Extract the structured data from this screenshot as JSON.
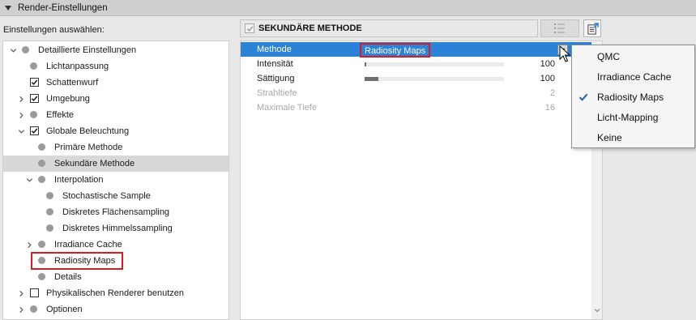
{
  "panel": {
    "title": "Render-Einstellungen"
  },
  "selector": {
    "label": "Einstellungen auswählen:"
  },
  "tree": [
    {
      "label": "Detaillierte Einstellungen",
      "type": "dot",
      "chevron": "down"
    },
    {
      "label": "Lichtanpassung",
      "type": "dot"
    },
    {
      "label": "Schattenwurf",
      "type": "checkbox",
      "checked": true
    },
    {
      "label": "Umgebung",
      "type": "checkbox",
      "checked": true,
      "chevron": "right"
    },
    {
      "label": "Effekte",
      "type": "dot",
      "chevron": "right"
    },
    {
      "label": "Globale Beleuchtung",
      "type": "checkbox",
      "checked": true,
      "chevron": "down"
    },
    {
      "label": "Primäre Methode",
      "type": "dot"
    },
    {
      "label": "Sekundäre Methode",
      "type": "dot",
      "selected": true
    },
    {
      "label": "Interpolation",
      "type": "dot",
      "chevron": "down"
    },
    {
      "label": "Stochastische Sample",
      "type": "dot"
    },
    {
      "label": "Diskretes Flächensampling",
      "type": "dot"
    },
    {
      "label": "Diskretes Himmelssampling",
      "type": "dot"
    },
    {
      "label": "Irradiance Cache",
      "type": "dot",
      "chevron": "right"
    },
    {
      "label": "Radiosity Maps",
      "type": "dot",
      "highlighted": true
    },
    {
      "label": "Details",
      "type": "dot"
    },
    {
      "label": "Physikalischen Renderer benutzen",
      "type": "checkbox",
      "checked": false,
      "chevron": "right"
    },
    {
      "label": "Optionen",
      "type": "dot",
      "chevron": "right"
    }
  ],
  "header": {
    "title": "SEKUNDÄRE METHODE",
    "checked": true
  },
  "properties": [
    {
      "name": "Methode",
      "value": "Radiosity Maps"
    },
    {
      "name": "Intensität",
      "value": "100",
      "level": 0.01
    },
    {
      "name": "Sättigung",
      "value": "100",
      "level": 0.1
    },
    {
      "name": "Strahltiefe",
      "value": "2",
      "disabled": true
    },
    {
      "name": "Maximale Tiefe",
      "value": "16",
      "disabled": true
    }
  ],
  "dropdown": {
    "options": [
      "QMC",
      "Irradiance Cache",
      "Radiosity Maps",
      "Licht-Mapping",
      "Keine"
    ],
    "selected": "Radiosity Maps"
  },
  "colors": {
    "selection": "#2b82d6",
    "highlight_border": "#e0191d",
    "tree_dot": "#9a9a9a"
  }
}
